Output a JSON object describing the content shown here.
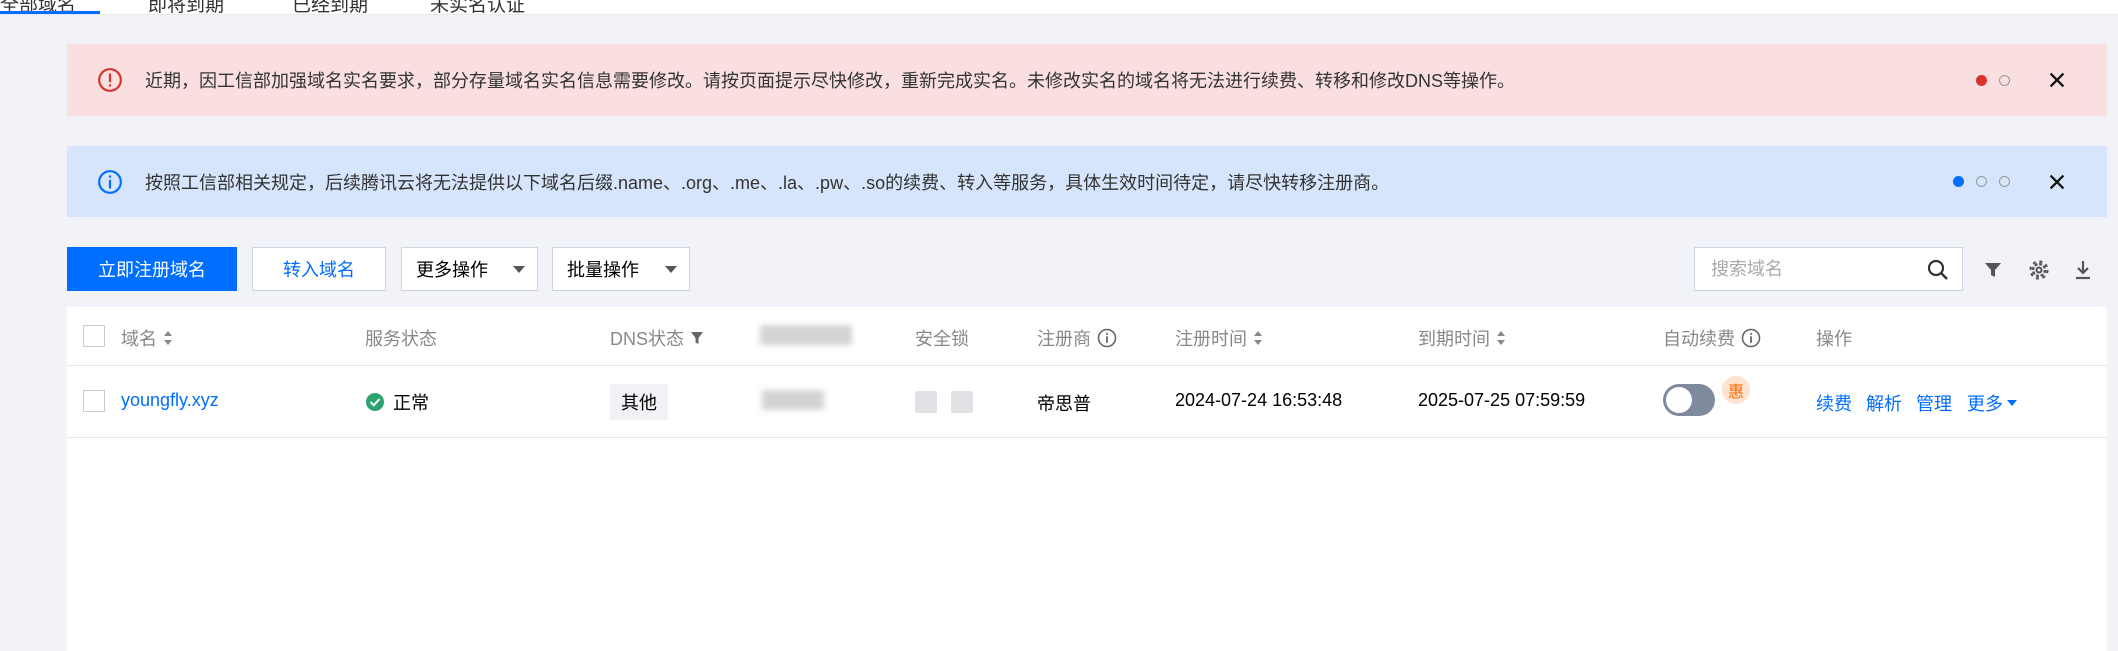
{
  "tabs": [
    {
      "label": "全部域名",
      "active": true
    },
    {
      "label": "即将到期"
    },
    {
      "label": "已经到期"
    },
    {
      "label": "未实名认证"
    }
  ],
  "alerts": {
    "red": {
      "text": "近期，因工信部加强域名实名要求，部分存量域名实名信息需要修改。请按页面提示尽快修改，重新完成实名。未修改实名的域名将无法进行续费、转移和修改DNS等操作。",
      "icon": "exclamation-circle-icon",
      "color": "#d9322c"
    },
    "blue": {
      "text": "按照工信部相关规定，后续腾讯云将无法提供以下域名后缀.name、.org、.me、.la、.pw、.so的续费、转入等服务，具体生效时间待定，请尽快转移注册商。",
      "icon": "info-circle-icon",
      "color": "#006eff"
    }
  },
  "toolbar": {
    "register_label": "立即注册域名",
    "transfer_label": "转入域名",
    "more_actions_label": "更多操作",
    "batch_actions_label": "批量操作",
    "search_placeholder": "搜索域名"
  },
  "table": {
    "headers": {
      "domain": "域名",
      "service_status": "服务状态",
      "dns_status": "DNS状态",
      "security_lock": "安全锁",
      "registrar": "注册商",
      "register_time": "注册时间",
      "expire_time": "到期时间",
      "auto_renew": "自动续费",
      "actions": "操作"
    },
    "rows": [
      {
        "domain": "youngfly.xyz",
        "service_status": "正常",
        "dns_status": "其他",
        "registrar": "帝思普",
        "register_time": "2024-07-24 16:53:48",
        "expire_time": "2025-07-25 07:59:59",
        "auto_renew": false,
        "promo_badge": "惠",
        "actions": {
          "renew": "续费",
          "resolve": "解析",
          "manage": "管理",
          "more": "更多"
        }
      }
    ]
  },
  "colors": {
    "accent": "#006eff",
    "success": "#2ba471",
    "danger": "#d9322c"
  }
}
